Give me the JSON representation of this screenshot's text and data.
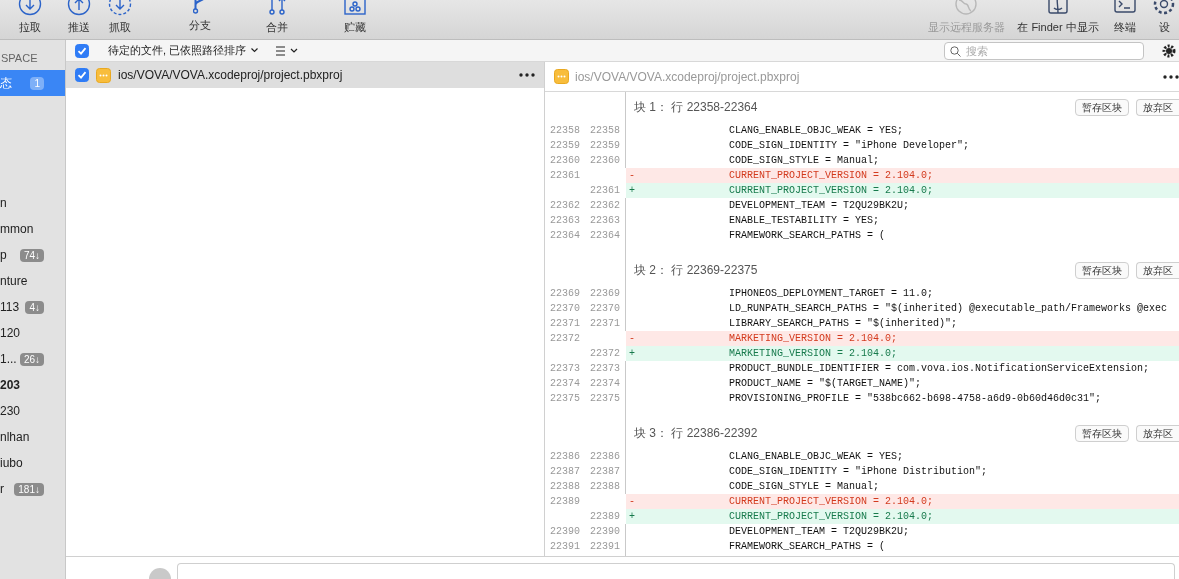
{
  "toolbar": {
    "left": [
      {
        "label": "拉取",
        "kind": "pull",
        "disabled": false
      },
      {
        "label": "推送",
        "kind": "push",
        "disabled": false
      },
      {
        "label": "抓取",
        "kind": "fetch",
        "disabled": false
      },
      {
        "label": "分支",
        "kind": "branch",
        "disabled": false
      },
      {
        "label": "合并",
        "kind": "merge",
        "disabled": false
      },
      {
        "label": "贮藏",
        "kind": "stash",
        "disabled": false
      }
    ],
    "right": [
      {
        "label": "显示远程服务器",
        "kind": "remote",
        "disabled": true
      },
      {
        "label": "在 Finder 中显示",
        "kind": "finder",
        "disabled": false
      },
      {
        "label": "终端",
        "kind": "terminal",
        "disabled": false
      },
      {
        "label": "设",
        "kind": "settings",
        "disabled": false
      }
    ]
  },
  "sidebar": {
    "header": "SPACE",
    "items": [
      {
        "label": "态",
        "badge": "1",
        "selected": true,
        "bold": false
      }
    ],
    "branches": [
      {
        "label": "n",
        "selected": false,
        "bold": false
      },
      {
        "label": "mmon",
        "selected": false,
        "bold": false
      },
      {
        "label": "p",
        "badge": "74↓",
        "selected": false,
        "bold": false
      },
      {
        "label": "nture",
        "selected": false,
        "bold": false
      },
      {
        "label": "113",
        "badge": "4↓",
        "selected": false,
        "bold": false
      },
      {
        "label": "120",
        "selected": false,
        "bold": false
      },
      {
        "label": "1...",
        "badge": "26↓",
        "selected": false,
        "bold": false
      },
      {
        "label": "203",
        "selected": false,
        "bold": true
      },
      {
        "label": "230",
        "selected": false,
        "bold": false
      },
      {
        "label": "nlhan",
        "selected": false,
        "bold": false
      },
      {
        "label": "iubo",
        "selected": false,
        "bold": false
      },
      {
        "label": "r",
        "badge": "181↓",
        "selected": false,
        "bold": false
      }
    ]
  },
  "file_bar": {
    "checked": true,
    "sort_label": "待定的文件, 已依照路径排序",
    "search": {
      "placeholder": "搜索"
    }
  },
  "files": [
    {
      "path": "ios/VOVA/VOVA.xcodeproj/project.pbxproj",
      "checked": true,
      "selected": true
    }
  ],
  "diff": {
    "path": "ios/VOVA/VOVA.xcodeproj/project.pbxproj",
    "hunks": [
      {
        "title": "块 1： 行 22358-22364",
        "stage": "暂存区块",
        "discard": "放弃区",
        "lines": [
          {
            "old": "22358",
            "new": "22358",
            "kind": "context",
            "text": "CLANG_ENABLE_OBJC_WEAK = YES;"
          },
          {
            "old": "22359",
            "new": "22359",
            "kind": "context",
            "text": "CODE_SIGN_IDENTITY = \"iPhone Developer\";"
          },
          {
            "old": "22360",
            "new": "22360",
            "kind": "context",
            "text": "CODE_SIGN_STYLE = Manual;"
          },
          {
            "old": "22361",
            "kind": "removed",
            "sign": "-",
            "text": "CURRENT_PROJECT_VERSION = 2.104.0;"
          },
          {
            "new": "22361",
            "kind": "added",
            "sign": "+",
            "text": "CURRENT_PROJECT_VERSION = 2.104.0;"
          },
          {
            "old": "22362",
            "new": "22362",
            "kind": "context",
            "text": "DEVELOPMENT_TEAM = T2QU29BK2U;"
          },
          {
            "old": "22363",
            "new": "22363",
            "kind": "context",
            "text": "ENABLE_TESTABILITY = YES;"
          },
          {
            "old": "22364",
            "new": "22364",
            "kind": "context",
            "text": "FRAMEWORK_SEARCH_PATHS = ("
          }
        ]
      },
      {
        "title": "块 2： 行 22369-22375",
        "stage": "暂存区块",
        "discard": "放弃区",
        "lines": [
          {
            "old": "22369",
            "new": "22369",
            "kind": "context",
            "text": "IPHONEOS_DEPLOYMENT_TARGET = 11.0;"
          },
          {
            "old": "22370",
            "new": "22370",
            "kind": "context",
            "text": "LD_RUNPATH_SEARCH_PATHS = \"$(inherited) @executable_path/Frameworks @exec"
          },
          {
            "old": "22371",
            "new": "22371",
            "kind": "context",
            "text": "LIBRARY_SEARCH_PATHS = \"$(inherited)\";"
          },
          {
            "old": "22372",
            "kind": "removed",
            "sign": "-",
            "text": "MARKETING_VERSION = 2.104.0;"
          },
          {
            "new": "22372",
            "kind": "added",
            "sign": "+",
            "text": "MARKETING_VERSION = 2.104.0;"
          },
          {
            "old": "22373",
            "new": "22373",
            "kind": "context",
            "text": "PRODUCT_BUNDLE_IDENTIFIER = com.vova.ios.NotificationServiceExtension;"
          },
          {
            "old": "22374",
            "new": "22374",
            "kind": "context",
            "text": "PRODUCT_NAME = \"$(TARGET_NAME)\";"
          },
          {
            "old": "22375",
            "new": "22375",
            "kind": "context",
            "text": "PROVISIONING_PROFILE = \"538bc662-b698-4758-a6d9-0b60d46d0c31\";"
          }
        ]
      },
      {
        "title": "块 3： 行 22386-22392",
        "stage": "暂存区块",
        "discard": "放弃区",
        "lines": [
          {
            "old": "22386",
            "new": "22386",
            "kind": "context",
            "text": "CLANG_ENABLE_OBJC_WEAK = YES;"
          },
          {
            "old": "22387",
            "new": "22387",
            "kind": "context",
            "text": "CODE_SIGN_IDENTITY = \"iPhone Distribution\";"
          },
          {
            "old": "22388",
            "new": "22388",
            "kind": "context",
            "text": "CODE_SIGN_STYLE = Manual;"
          },
          {
            "old": "22389",
            "kind": "removed",
            "sign": "-",
            "text": "CURRENT_PROJECT_VERSION = 2.104.0;"
          },
          {
            "new": "22389",
            "kind": "added",
            "sign": "+",
            "text": "CURRENT_PROJECT_VERSION = 2.104.0;"
          },
          {
            "old": "22390",
            "new": "22390",
            "kind": "context",
            "text": "DEVELOPMENT_TEAM = T2QU29BK2U;"
          },
          {
            "old": "22391",
            "new": "22391",
            "kind": "context",
            "text": "FRAMEWORK_SEARCH_PATHS = ("
          }
        ]
      }
    ]
  }
}
